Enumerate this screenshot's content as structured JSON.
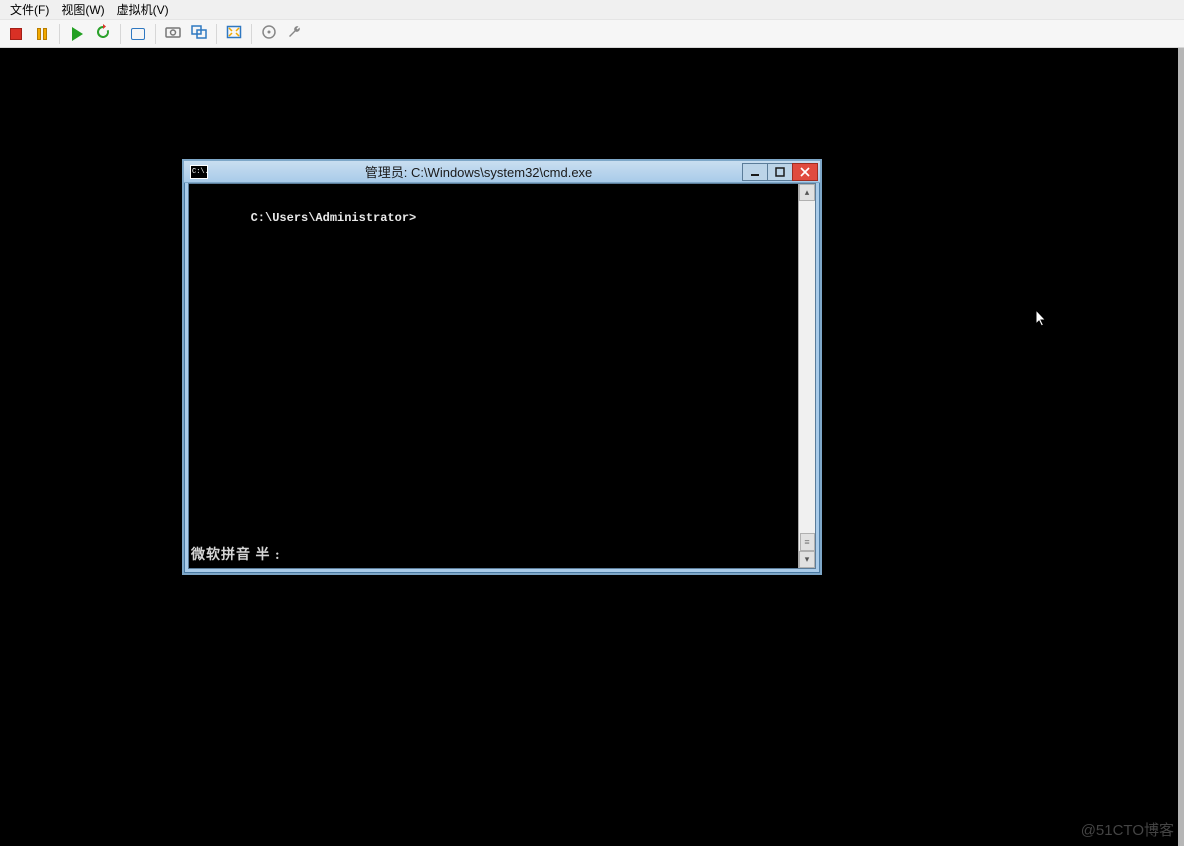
{
  "menubar": {
    "file": "文件(F)",
    "view": "视图(W)",
    "vm": "虚拟机(V)"
  },
  "toolbar": {
    "stop": "stop-vm",
    "pause": "pause-vm",
    "play": "start-vm",
    "recycle": "restart-vm",
    "snapshot": "snapshot",
    "screenshot": "screenshot",
    "unity": "unity-mode",
    "fullscreen": "fullscreen",
    "install": "install-tools",
    "help": "help",
    "settings": "settings"
  },
  "cmd": {
    "sysicon_text": "C:\\.",
    "title": "管理员: C:\\Windows\\system32\\cmd.exe",
    "prompt": "C:\\Users\\Administrator>",
    "ime": "微软拼音 半 :"
  },
  "watermark": "@51CTO博客"
}
